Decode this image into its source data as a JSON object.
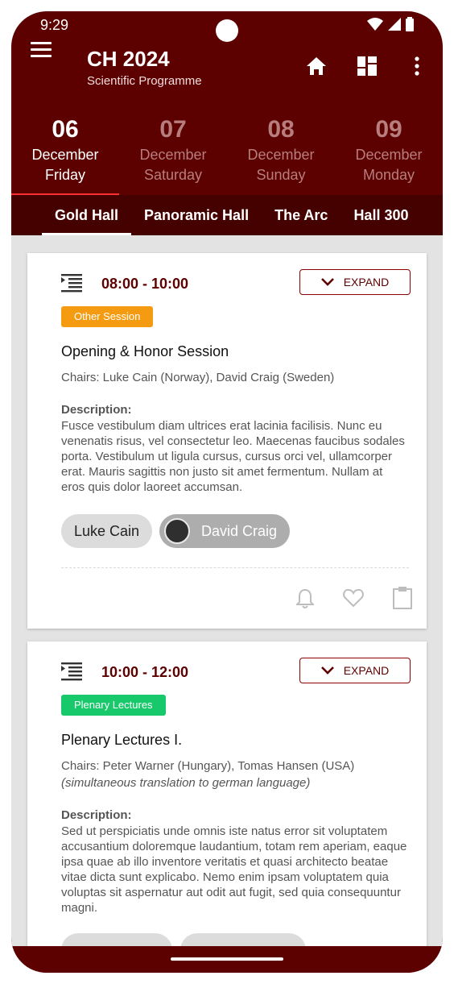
{
  "status_bar": {
    "time": "9:29"
  },
  "app_bar": {
    "title": "CH 2024",
    "subtitle": "Scientific Programme",
    "icons": [
      "menu-icon",
      "home-icon",
      "dashboard-icon",
      "more-vert-icon"
    ]
  },
  "days": [
    {
      "num": "06",
      "month": "December",
      "weekday": "Friday",
      "active": true
    },
    {
      "num": "07",
      "month": "December",
      "weekday": "Saturday",
      "active": false
    },
    {
      "num": "08",
      "month": "December",
      "weekday": "Sunday",
      "active": false
    },
    {
      "num": "09",
      "month": "December",
      "weekday": "Monday",
      "active": false
    }
  ],
  "halls": [
    "Gold Hall",
    "Panoramic Hall",
    "The Arc",
    "Hall 300"
  ],
  "expand_label": "EXPAND",
  "sessions": [
    {
      "time": "08:00 - 10:00",
      "type": "Other Session",
      "type_color": "#f59b12",
      "title": "Opening & Honor Session",
      "chairs": "Chairs: Luke Cain (Norway), David Craig (Sweden)",
      "desc_label": "Description:",
      "description": "Fusce vestibulum diam ultrices erat lacinia facilisis. Nunc eu venenatis risus, vel consectetur leo. Maecenas faucibus sodales porta. Vestibulum ut ligula cursus, cursus orci vel, ullamcorper erat. Mauris sagittis non justo sit amet fermentum. Nullam at eros quis dolor laoreet accumsan.",
      "speakers": [
        "Luke Cain",
        "David Craig"
      ]
    },
    {
      "time": "10:00 - 12:00",
      "type": "Plenary Lectures",
      "type_color": "#18c96b",
      "title": "Plenary Lectures I.",
      "chairs": "Chairs: Peter Warner (Hungary), Tomas Hansen (USA)",
      "note": "(simultaneous translation to german language)",
      "desc_label": "Description:",
      "description": "Sed ut perspiciatis unde omnis iste natus error sit voluptatem accusantium doloremque laudantium, totam rem aperiam, eaque ipsa quae ab illo inventore veritatis et quasi architecto beatae vitae dicta sunt explicabo. Nemo enim ipsam voluptatem quia voluptas sit aspernatur aut odit aut fugit, sed quia consequuntur magni."
    }
  ],
  "colors": {
    "primary": "#5c0000",
    "primary_dark": "#450000",
    "accent_underline": "#ff2f2f"
  }
}
